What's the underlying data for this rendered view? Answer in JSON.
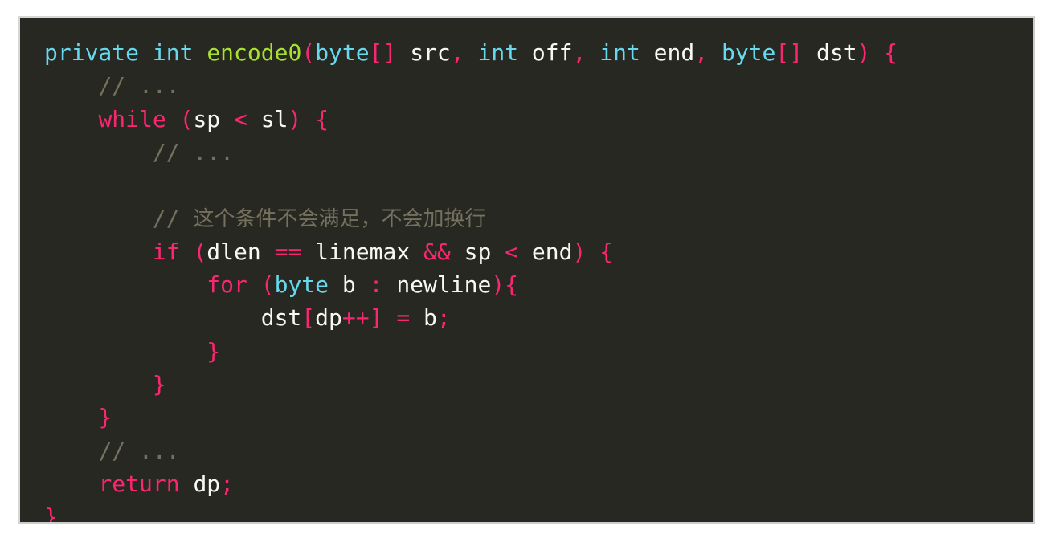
{
  "editor": {
    "language": "java",
    "theme": "monokai",
    "background_color": "#272822",
    "page_background_color": "#ffffff",
    "border_color": "#cfd0d0",
    "colors": {
      "keyword": "#66d9ef",
      "control": "#f92672",
      "function": "#a6e22e",
      "identifier": "#f8f8f2",
      "comment": "#75715e"
    }
  },
  "code": {
    "lines": [
      {
        "index": 1,
        "indent": 0,
        "text": "private int encode0(byte[] src, int off, int end, byte[] dst) {",
        "tokens": [
          {
            "t": "private",
            "c": "kw"
          },
          {
            "t": " ",
            "c": "id"
          },
          {
            "t": "int",
            "c": "kw"
          },
          {
            "t": " ",
            "c": "id"
          },
          {
            "t": "encode0",
            "c": "fn"
          },
          {
            "t": "(",
            "c": "ctrl"
          },
          {
            "t": "byte",
            "c": "kw"
          },
          {
            "t": "[]",
            "c": "ctrl"
          },
          {
            "t": " src",
            "c": "id"
          },
          {
            "t": ",",
            "c": "ctrl"
          },
          {
            "t": " ",
            "c": "id"
          },
          {
            "t": "int",
            "c": "kw"
          },
          {
            "t": " off",
            "c": "id"
          },
          {
            "t": ",",
            "c": "ctrl"
          },
          {
            "t": " ",
            "c": "id"
          },
          {
            "t": "int",
            "c": "kw"
          },
          {
            "t": " end",
            "c": "id"
          },
          {
            "t": ",",
            "c": "ctrl"
          },
          {
            "t": " ",
            "c": "id"
          },
          {
            "t": "byte",
            "c": "kw"
          },
          {
            "t": "[]",
            "c": "ctrl"
          },
          {
            "t": " dst",
            "c": "id"
          },
          {
            "t": ")",
            "c": "ctrl"
          },
          {
            "t": " ",
            "c": "id"
          },
          {
            "t": "{",
            "c": "ctrl"
          }
        ]
      },
      {
        "index": 2,
        "indent": 4,
        "text": "    // ...",
        "tokens": [
          {
            "t": "    ",
            "c": "id"
          },
          {
            "t": "// ...",
            "c": "cmt"
          }
        ]
      },
      {
        "index": 3,
        "indent": 4,
        "text": "    while (sp < sl) {",
        "tokens": [
          {
            "t": "    ",
            "c": "id"
          },
          {
            "t": "while",
            "c": "ctrl"
          },
          {
            "t": " ",
            "c": "id"
          },
          {
            "t": "(",
            "c": "ctrl"
          },
          {
            "t": "sp",
            "c": "id"
          },
          {
            "t": " ",
            "c": "id"
          },
          {
            "t": "<",
            "c": "ctrl"
          },
          {
            "t": " sl",
            "c": "id"
          },
          {
            "t": ")",
            "c": "ctrl"
          },
          {
            "t": " ",
            "c": "id"
          },
          {
            "t": "{",
            "c": "ctrl"
          }
        ]
      },
      {
        "index": 4,
        "indent": 8,
        "text": "        // ...",
        "tokens": [
          {
            "t": "        ",
            "c": "id"
          },
          {
            "t": "// ...",
            "c": "cmt"
          }
        ]
      },
      {
        "index": 5,
        "indent": 0,
        "text": "",
        "tokens": []
      },
      {
        "index": 6,
        "indent": 8,
        "text": "        // 这个条件不会满足，不会加换行",
        "tokens": [
          {
            "t": "        ",
            "c": "id"
          },
          {
            "t": "// ",
            "c": "cmt"
          },
          {
            "t": "这个条件不会满足，不会加换行",
            "c": "cmt-cjk"
          }
        ]
      },
      {
        "index": 7,
        "indent": 8,
        "text": "        if (dlen == linemax && sp < end) {",
        "tokens": [
          {
            "t": "        ",
            "c": "id"
          },
          {
            "t": "if",
            "c": "ctrl"
          },
          {
            "t": " ",
            "c": "id"
          },
          {
            "t": "(",
            "c": "ctrl"
          },
          {
            "t": "dlen",
            "c": "id"
          },
          {
            "t": " ",
            "c": "id"
          },
          {
            "t": "==",
            "c": "ctrl"
          },
          {
            "t": " linemax ",
            "c": "id"
          },
          {
            "t": "&&",
            "c": "ctrl"
          },
          {
            "t": " sp ",
            "c": "id"
          },
          {
            "t": "<",
            "c": "ctrl"
          },
          {
            "t": " end",
            "c": "id"
          },
          {
            "t": ")",
            "c": "ctrl"
          },
          {
            "t": " ",
            "c": "id"
          },
          {
            "t": "{",
            "c": "ctrl"
          }
        ]
      },
      {
        "index": 8,
        "indent": 12,
        "text": "            for (byte b : newline){",
        "tokens": [
          {
            "t": "            ",
            "c": "id"
          },
          {
            "t": "for",
            "c": "ctrl"
          },
          {
            "t": " ",
            "c": "id"
          },
          {
            "t": "(",
            "c": "ctrl"
          },
          {
            "t": "byte",
            "c": "kw"
          },
          {
            "t": " b ",
            "c": "id"
          },
          {
            "t": ":",
            "c": "ctrl"
          },
          {
            "t": " newline",
            "c": "id"
          },
          {
            "t": ")",
            "c": "ctrl"
          },
          {
            "t": "{",
            "c": "ctrl"
          }
        ]
      },
      {
        "index": 9,
        "indent": 16,
        "text": "                dst[dp++] = b;",
        "tokens": [
          {
            "t": "                ",
            "c": "id"
          },
          {
            "t": "dst",
            "c": "id"
          },
          {
            "t": "[",
            "c": "ctrl"
          },
          {
            "t": "dp",
            "c": "id"
          },
          {
            "t": "++",
            "c": "ctrl"
          },
          {
            "t": "]",
            "c": "ctrl"
          },
          {
            "t": " ",
            "c": "id"
          },
          {
            "t": "=",
            "c": "ctrl"
          },
          {
            "t": " b",
            "c": "id"
          },
          {
            "t": ";",
            "c": "ctrl"
          }
        ]
      },
      {
        "index": 10,
        "indent": 12,
        "text": "            }",
        "tokens": [
          {
            "t": "            ",
            "c": "id"
          },
          {
            "t": "}",
            "c": "ctrl"
          }
        ]
      },
      {
        "index": 11,
        "indent": 8,
        "text": "        }",
        "tokens": [
          {
            "t": "        ",
            "c": "id"
          },
          {
            "t": "}",
            "c": "ctrl"
          }
        ]
      },
      {
        "index": 12,
        "indent": 4,
        "text": "    }",
        "tokens": [
          {
            "t": "    ",
            "c": "id"
          },
          {
            "t": "}",
            "c": "ctrl"
          }
        ]
      },
      {
        "index": 13,
        "indent": 4,
        "text": "    // ...",
        "tokens": [
          {
            "t": "    ",
            "c": "id"
          },
          {
            "t": "// ...",
            "c": "cmt"
          }
        ]
      },
      {
        "index": 14,
        "indent": 4,
        "text": "    return dp;",
        "tokens": [
          {
            "t": "    ",
            "c": "id"
          },
          {
            "t": "return",
            "c": "ctrl"
          },
          {
            "t": " dp",
            "c": "id"
          },
          {
            "t": ";",
            "c": "ctrl"
          }
        ]
      },
      {
        "index": 15,
        "indent": 0,
        "text": "}",
        "tokens": [
          {
            "t": "}",
            "c": "ctrl"
          }
        ]
      }
    ]
  }
}
